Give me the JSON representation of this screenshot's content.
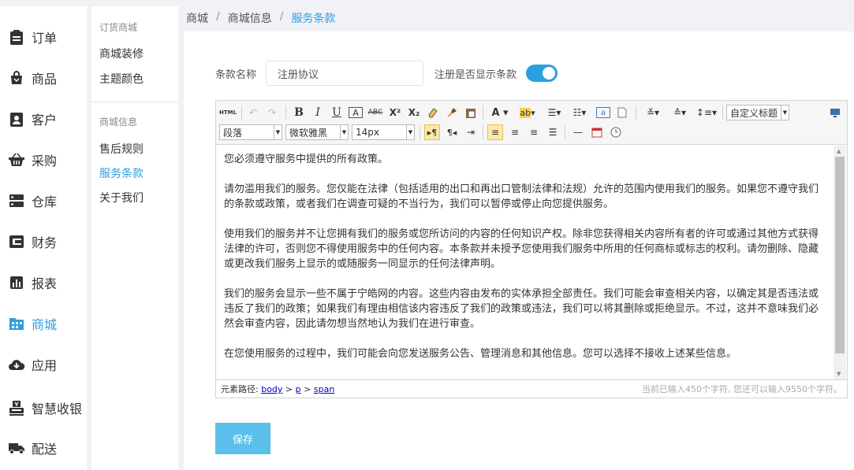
{
  "nav": {
    "items": [
      {
        "label": "订单",
        "icon": "clipboard-icon"
      },
      {
        "label": "商品",
        "icon": "shopping-bag-icon"
      },
      {
        "label": "客户",
        "icon": "contact-card-icon"
      },
      {
        "label": "采购",
        "icon": "basket-icon"
      },
      {
        "label": "仓库",
        "icon": "server-icon"
      },
      {
        "label": "财务",
        "icon": "wallet-icon"
      },
      {
        "label": "报表",
        "icon": "bar-chart-icon"
      },
      {
        "label": "商城",
        "icon": "store-icon"
      },
      {
        "label": "应用",
        "icon": "cloud-download-icon"
      },
      {
        "label": "智慧收银",
        "icon": "cashier-icon"
      },
      {
        "label": "配送",
        "icon": "truck-icon"
      }
    ],
    "active": "商城"
  },
  "subnav": {
    "group1": "订货商城",
    "group1_items": [
      "商城装修",
      "主题颜色"
    ],
    "group2": "商城信息",
    "group2_items": [
      "售后规则",
      "服务条款",
      "关于我们"
    ],
    "active": "服务条款"
  },
  "breadcrumb": [
    "商城",
    "商城信息",
    "服务条款"
  ],
  "form": {
    "name_label": "条款名称",
    "name_value": "注册协议",
    "show_label": "注册是否显示条款",
    "show_enabled": true
  },
  "editor": {
    "html_label": "HTML",
    "paragraph_select": "段落",
    "font_select": "微软雅黑",
    "size_select": "14px",
    "title_select": "自定义标题",
    "content": [
      "您必须遵守服务中提供的所有政策。",
      "请勿滥用我们的服务。您仅能在法律（包括适用的出口和再出口管制法律和法规）允许的范围内使用我们的服务。如果您不遵守我们的条款或政策，或者我们在调查可疑的不当行为，我们可以暂停或停止向您提供服务。",
      "使用我们的服务并不让您拥有我们的服务或您所访问的内容的任何知识产权。除非您获得相关内容所有者的许可或通过其他方式获得法律的许可，否则您不得使用服务中的任何内容。本条款并未授予您使用我们服务中所用的任何商标或标志的权利。请勿删除、隐藏或更改我们服务上显示的或随服务一同显示的任何法律声明。",
      "我们的服务会显示一些不属于宁皓网的内容。这些内容由发布的实体承担全部责任。我们可能会审查相关内容，以确定其是否违法或违反了我们的政策；如果我们有理由相信该内容违反了我们的政策或违法，我们可以将其删除或拒绝显示。不过，这并不意味我们必然会审查内容，因此请勿想当然地认为我们在进行审查。",
      "在您使用服务的过程中，我们可能会向您发送服务公告、管理消息和其他信息。您可以选择不接收上述某些信息。"
    ],
    "path_label": "元素路径:",
    "path": [
      "body",
      "p",
      "span"
    ],
    "counter": "当前已输入450个字符, 您还可以输入9550个字符。"
  },
  "save_label": "保存",
  "colors": {
    "accent": "#2b9fe0",
    "save": "#5bc0eb"
  }
}
